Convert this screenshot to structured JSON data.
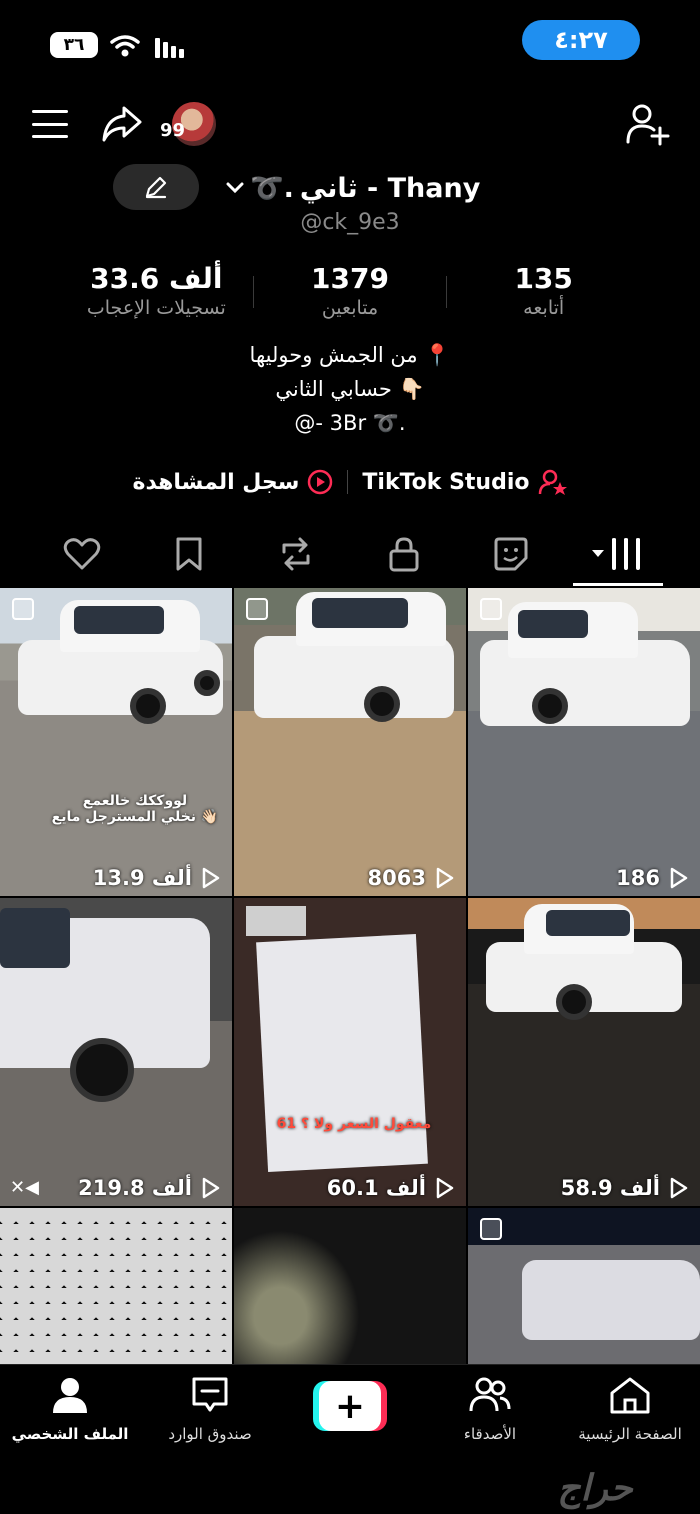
{
  "status": {
    "time": "٤:٢٧",
    "battery": "٣٦"
  },
  "header": {
    "avatar_count": "99",
    "display_name": "ثاني - Thany",
    "name_suffix": "➰.",
    "username": "@ck_9e3"
  },
  "stats": {
    "likes_value": "33.6 ألف",
    "likes_label": "تسجيلات الإعجاب",
    "followers_value": "1379",
    "followers_label": "متابعين",
    "following_value": "135",
    "following_label": "أتابعه"
  },
  "bio": {
    "line1": "من الجمش وحوليها 📍",
    "line2": "حسابي الثاني 👇🏻",
    "line3": "@- 3Br ➰."
  },
  "links": {
    "watch_history": "سجل المشاهدة",
    "studio": "TikTok Studio"
  },
  "tabs": [
    "videos",
    "private",
    "reposts",
    "favorites",
    "liked"
  ],
  "grid": {
    "items": [
      {
        "views": "13.9 ألف",
        "caption": "لووككك خالعمع\nنخلي المسترجل مايع 👋🏻"
      },
      {
        "views": "8063"
      },
      {
        "views": "186"
      },
      {
        "views": "219.8 ألف"
      },
      {
        "views": "60.1 ألف",
        "caption": "61 معقول السعر ولا ؟"
      },
      {
        "views": "58.9 ألف"
      }
    ]
  },
  "nav": {
    "home": "الصفحة الرئيسية",
    "friends": "الأصدقاء",
    "create": "+",
    "inbox": "صندوق الوارد",
    "profile": "الملف الشخصي"
  },
  "watermark": "حراج",
  "colors": {
    "accent_blue": "#1f8ff0",
    "tiktok_red": "#fe2c55",
    "tiktok_cyan": "#25f4ee"
  }
}
